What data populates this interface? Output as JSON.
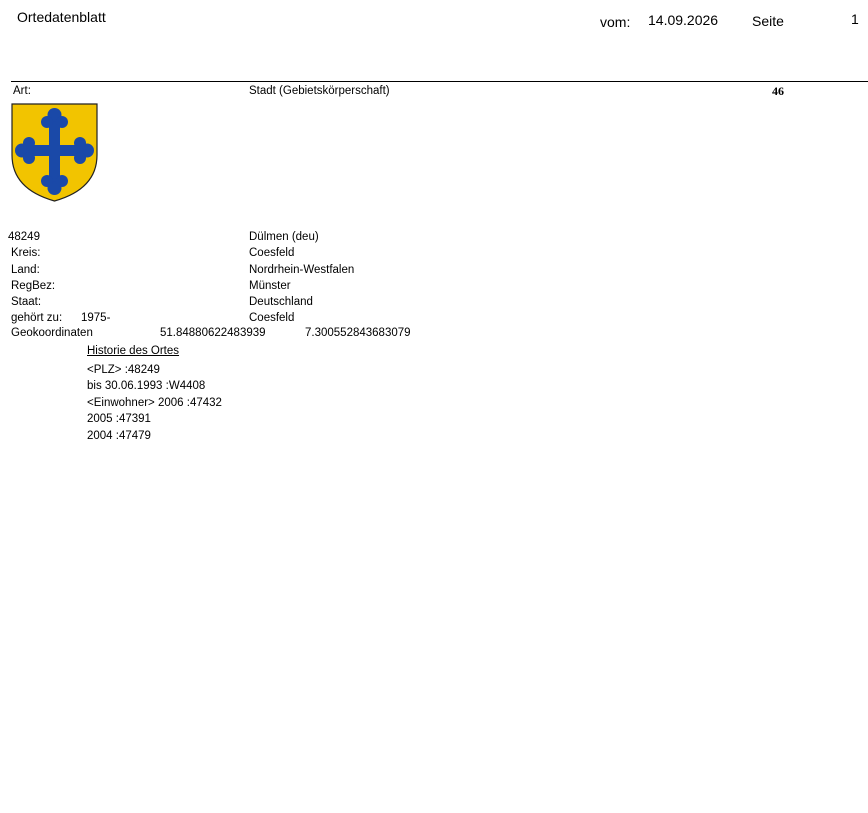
{
  "header": {
    "title": "Ortedatenblatt",
    "date_label": "vom:",
    "date_value": "14.09.2026",
    "page_label": "Seite",
    "page_number": "1"
  },
  "type_row": {
    "label": "Art:",
    "value": "Stadt (Gebietskörperschaft)",
    "number": "46"
  },
  "coat_of_arms": {
    "icon": "coat-of-arms-icon",
    "shield_color": "#F2C400",
    "cross_color": "#1A49A8"
  },
  "details": {
    "postcode": "48249",
    "name": "Dülmen (deu)",
    "kreis_label": "Kreis:",
    "kreis_value": "Coesfeld",
    "land_label": "Land:",
    "land_value": "Nordrhein-Westfalen",
    "regbez_label": "RegBez:",
    "regbez_value": "Münster",
    "staat_label": "Staat:",
    "staat_value": "Deutschland",
    "belongs_label": "gehört zu:",
    "belongs_since": "1975-",
    "belongs_value": "Coesfeld",
    "geo_label": "Geokoordinaten",
    "geo_lat": "51.84880622483939",
    "geo_lon": "7.300552843683079"
  },
  "history": {
    "heading": "Historie des Ortes",
    "lines": [
      "<PLZ> :48249",
      "bis 30.06.1993 :W4408",
      "<Einwohner> 2006 :47432",
      "2005 :47391",
      "2004 :47479"
    ]
  }
}
